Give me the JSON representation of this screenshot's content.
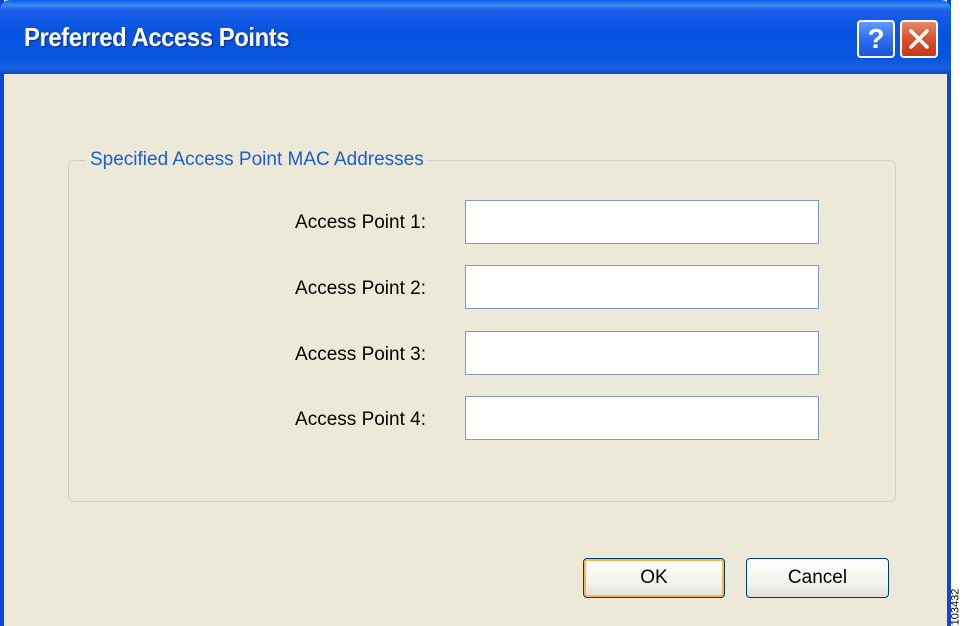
{
  "window": {
    "title": "Preferred Access Points",
    "help_glyph": "?",
    "close_glyph": "✕"
  },
  "group": {
    "legend": "Specified Access Point MAC Addresses"
  },
  "access_points": [
    {
      "label": "Access Point 1:",
      "value": ""
    },
    {
      "label": "Access Point 2:",
      "value": ""
    },
    {
      "label": "Access Point 3:",
      "value": ""
    },
    {
      "label": "Access Point 4:",
      "value": ""
    }
  ],
  "buttons": {
    "ok": "OK",
    "cancel": "Cancel"
  },
  "figure_id": "103432",
  "colors": {
    "titlebar": "#0752df",
    "dialog_bg": "#ece9d8",
    "legend_text": "#1a5ed6",
    "input_border": "#7f9db9",
    "close_button": "#d9512d",
    "default_button_focus": "#f8b849"
  },
  "icons": {
    "help": "question-mark-icon",
    "close": "close-x-icon"
  }
}
